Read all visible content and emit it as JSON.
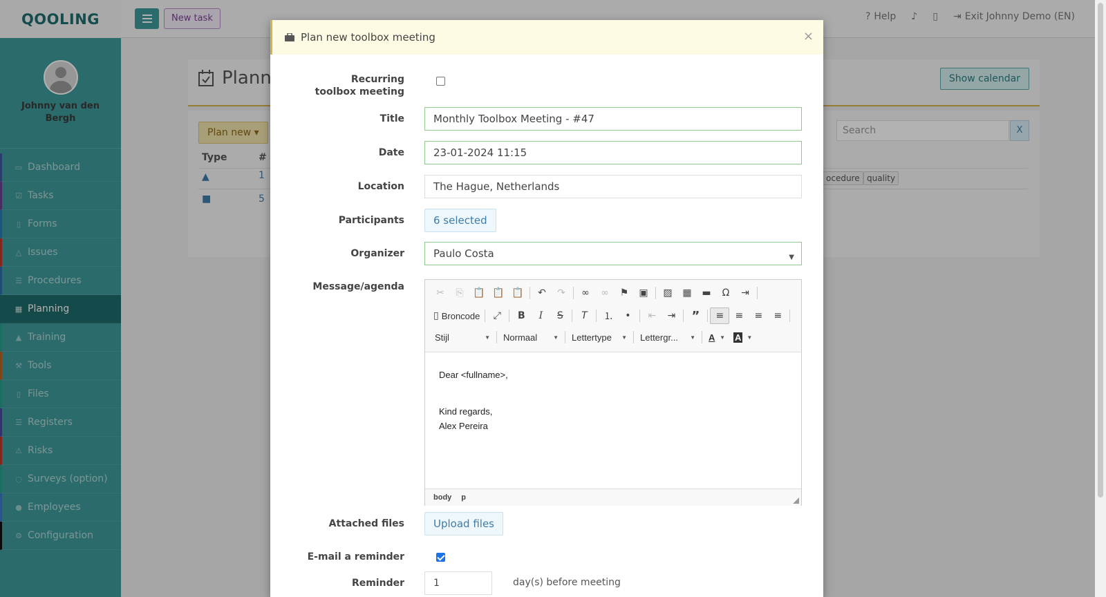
{
  "app": {
    "brand": "QOOLING"
  },
  "user": {
    "name": "Johnny van den Bergh"
  },
  "sidebar": {
    "items": [
      {
        "label": "Dashboard",
        "color": "#3b5998"
      },
      {
        "label": "Tasks",
        "color": "#6b3f8f"
      },
      {
        "label": "Forms",
        "color": "#2a7ab0"
      },
      {
        "label": "Issues",
        "color": "#c0392b"
      },
      {
        "label": "Procedures",
        "color": "#2c6fa3"
      },
      {
        "label": "Planning",
        "color": "#1f6b6b"
      },
      {
        "label": "Training",
        "color": "#2a9d8f"
      },
      {
        "label": "Tools",
        "color": "#b5651d"
      },
      {
        "label": "Files",
        "color": "#2a9d8f"
      },
      {
        "label": "Registers",
        "color": "#4a4a9a"
      },
      {
        "label": "Risks",
        "color": "#c0392b"
      },
      {
        "label": "Surveys (option)",
        "color": "#2a9d8f"
      },
      {
        "label": "Employees",
        "color": "#3a7abf"
      },
      {
        "label": "Configuration",
        "color": "#111111"
      }
    ]
  },
  "topbar": {
    "new_task": "New task",
    "help": "Help",
    "exit": "Exit Johnny Demo (EN)"
  },
  "page": {
    "title": "Planni",
    "show_calendar": "Show calendar",
    "plan_new": "Plan new",
    "table": {
      "col_type": "Type",
      "col_num": "#",
      "rows": [
        {
          "num": "1"
        },
        {
          "num": "5"
        }
      ]
    },
    "search_placeholder": "Search",
    "search_clear": "X",
    "tags": [
      "ocedure",
      "quality"
    ]
  },
  "modal": {
    "title": "Plan new toolbox meeting",
    "close": "×",
    "fields": {
      "recurring_label": "Recurring toolbox meeting",
      "title_label": "Title",
      "title_value": "Monthly Toolbox Meeting - #47",
      "date_label": "Date",
      "date_value": "23-01-2024 11:15",
      "location_label": "Location",
      "location_value": "The Hague, Netherlands",
      "participants_label": "Participants",
      "participants_value": "6 selected",
      "organizer_label": "Organizer",
      "organizer_value": "Paulo Costa",
      "message_label": "Message/agenda",
      "attached_label": "Attached files",
      "upload_label": "Upload files",
      "reminder_email_label": "E-mail a reminder",
      "reminder_label": "Reminder",
      "reminder_value": "1",
      "reminder_suffix": "day(s) before meeting"
    },
    "editor": {
      "source_label": "Broncode",
      "style_combo": "Stijl",
      "format_combo": "Normaal",
      "font_combo": "Lettertype",
      "size_combo": "Lettergr...",
      "lines": [
        "Dear <fullname>,",
        "",
        "Kind regards,",
        "Alex Pereira"
      ],
      "path": [
        "body",
        "p"
      ]
    }
  }
}
